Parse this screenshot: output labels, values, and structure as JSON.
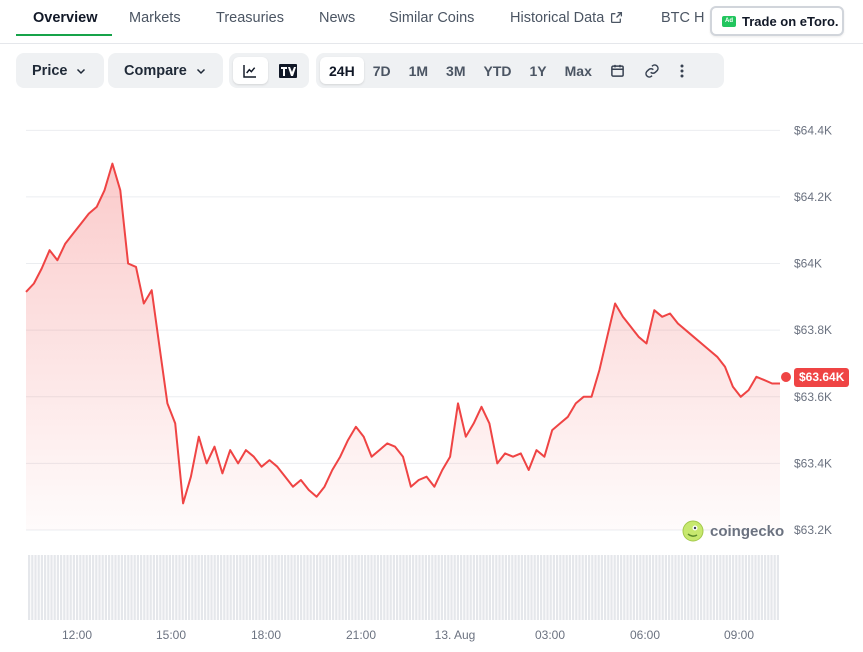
{
  "tabs": [
    {
      "label": "Overview",
      "active": true
    },
    {
      "label": "Markets"
    },
    {
      "label": "Treasuries"
    },
    {
      "label": "News"
    },
    {
      "label": "Similar Coins"
    },
    {
      "label": "Historical Data"
    },
    {
      "label": "BTC H"
    }
  ],
  "ad": {
    "badge": "Ad",
    "label": "Trade on eToro."
  },
  "toolbar": {
    "price_label": "Price",
    "compare_label": "Compare",
    "chart_type_icons": [
      "line-chart-icon",
      "tradingview-icon"
    ],
    "ranges": [
      "24H",
      "7D",
      "1M",
      "3M",
      "YTD",
      "1Y",
      "Max"
    ],
    "selected_range": "24H",
    "extra_icons": [
      "calendar-icon",
      "link-icon",
      "more-icon"
    ]
  },
  "current_price": "$63.64K",
  "watermark": "coingecko",
  "colors": {
    "line": "#ef4444",
    "accent": "#16a34a",
    "grid": "#ebedf0"
  },
  "chart_data": {
    "type": "area",
    "y_ticks": [
      "$64.4K",
      "$64.2K",
      "$64K",
      "$63.8K",
      "$63.6K",
      "$63.4K",
      "$63.2K"
    ],
    "x_ticks": [
      "12:00",
      "15:00",
      "18:00",
      "21:00",
      "13. Aug",
      "03:00",
      "06:00",
      "09:00"
    ],
    "ylim": [
      63200,
      64440
    ],
    "x_hours": [
      0,
      0.25,
      0.5,
      0.75,
      1.0,
      1.25,
      1.5,
      1.75,
      2.0,
      2.25,
      2.5,
      2.75,
      3.0,
      3.25,
      3.5,
      3.75,
      4.0,
      4.25,
      4.5,
      4.75,
      5.0,
      5.25,
      5.5,
      5.75,
      6.0,
      6.25,
      6.5,
      6.75,
      7.0,
      7.25,
      7.5,
      7.75,
      8.0,
      8.25,
      8.5,
      8.75,
      9.0,
      9.25,
      9.5,
      9.75,
      10.0,
      10.25,
      10.5,
      10.75,
      11.0,
      11.25,
      11.5,
      11.75,
      12.0,
      12.25,
      12.5,
      12.75,
      13.0,
      13.25,
      13.5,
      13.75,
      14.0,
      14.25,
      14.5,
      14.75,
      15.0,
      15.25,
      15.5,
      15.75,
      16.0,
      16.25,
      16.5,
      16.75,
      17.0,
      17.25,
      17.5,
      17.75,
      18.0,
      18.25,
      18.5,
      18.75,
      19.0,
      19.25,
      19.5,
      19.75,
      20.0,
      20.25,
      20.5,
      20.75,
      21.0,
      21.25,
      21.5,
      21.75,
      22.0,
      22.25,
      22.5,
      22.75,
      23.0,
      23.25,
      23.5,
      23.75,
      24.0
    ],
    "values": [
      63915,
      63940,
      63985,
      64040,
      64010,
      64060,
      64090,
      64120,
      64150,
      64170,
      64220,
      64300,
      64220,
      64000,
      63990,
      63880,
      63920,
      63750,
      63580,
      63520,
      63280,
      63360,
      63480,
      63400,
      63450,
      63370,
      63440,
      63400,
      63440,
      63420,
      63390,
      63410,
      63390,
      63360,
      63330,
      63350,
      63320,
      63300,
      63330,
      63380,
      63420,
      63470,
      63510,
      63480,
      63420,
      63440,
      63460,
      63450,
      63420,
      63330,
      63350,
      63360,
      63330,
      63380,
      63420,
      63580,
      63480,
      63520,
      63570,
      63520,
      63400,
      63430,
      63420,
      63430,
      63380,
      63440,
      63420,
      63500,
      63520,
      63540,
      63580,
      63600,
      63600,
      63680,
      63780,
      63880,
      63840,
      63810,
      63780,
      63760,
      63860,
      63840,
      63850,
      63820,
      63800,
      63780,
      63760,
      63740,
      63720,
      63690,
      63630,
      63600,
      63620,
      63660,
      63650,
      63640,
      63640
    ],
    "volume": "uniform bars",
    "grid": true,
    "tooltip": "current price tag right"
  }
}
